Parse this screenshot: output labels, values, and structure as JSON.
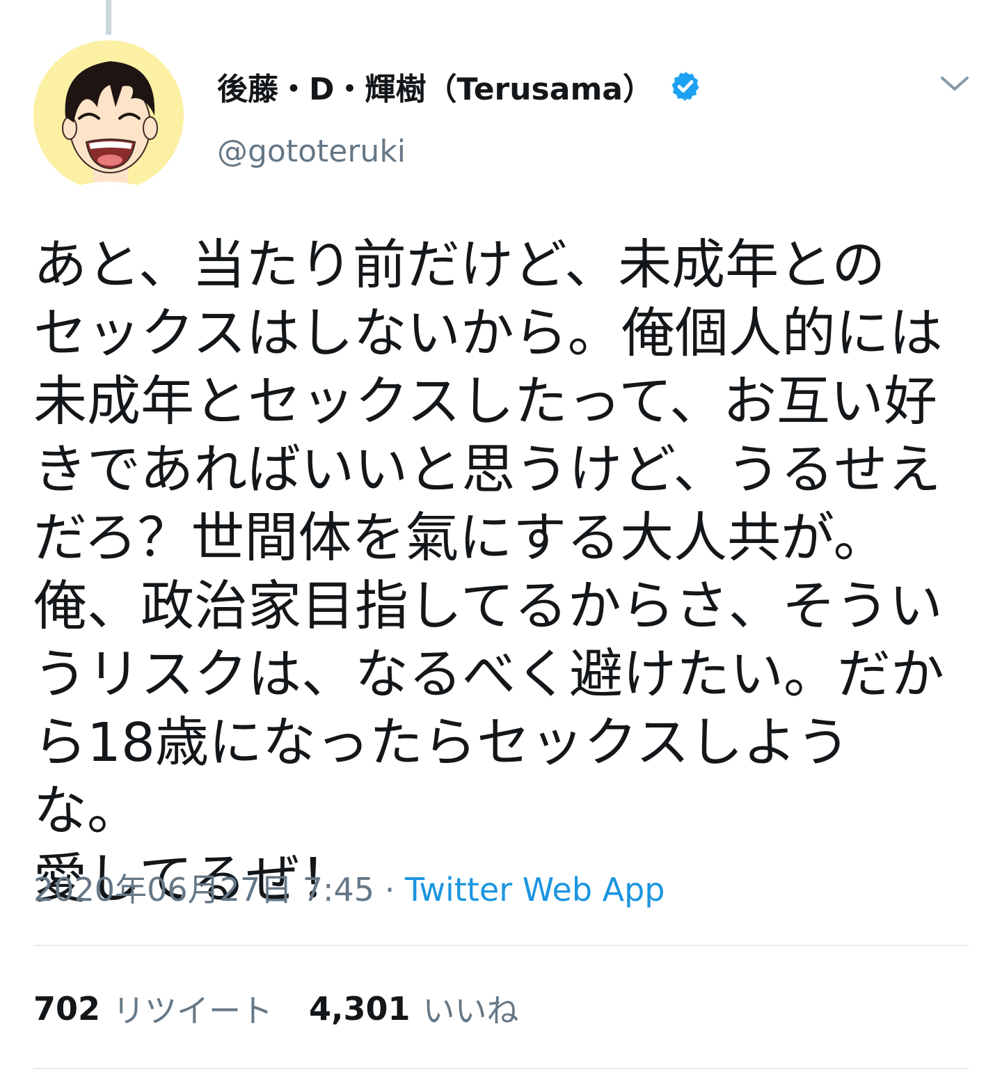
{
  "tweet": {
    "author": {
      "display_name": "後藤・D・輝樹（Terusama）",
      "handle": "@gototeruki",
      "verified": true,
      "avatar_icon": "cartoon-smiling-face-avatar"
    },
    "text": "あと、当たり前だけど、未成年との\nセックスはしないから。俺個人的には\n未成年とセックスしたって、お互い好\nきであればいいと思うけど、うるせえ\nだろ？世間体を氣にする大人共が。\n俺、政治家目指してるからさ、そうい\nうリスクは、なるべく避けたい。だか\nら18歳になったらセックスしような。\n愛してるぜ！",
    "timestamp": "2020年06月27日 7:45",
    "separator": "·",
    "source": "Twitter Web App",
    "stats": {
      "retweets_count": "702",
      "retweets_label": "リツイート",
      "likes_count": "4,301",
      "likes_label": "いいね"
    }
  },
  "icons": {
    "verified": "verified-badge-icon",
    "caret": "chevron-down-icon"
  },
  "colors": {
    "text_primary": "#14171a",
    "text_secondary": "#657786",
    "link": "#1b95e0",
    "verified_badge": "#1da1f2",
    "divider": "#e6ecf0",
    "avatar_background": "#fbf0a4"
  }
}
